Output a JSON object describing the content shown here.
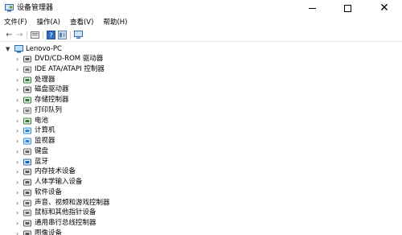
{
  "window": {
    "title": "设备管理器",
    "controls": {
      "minimize": "—",
      "maximize": "☐",
      "close": "✕"
    }
  },
  "menubar": {
    "items": [
      {
        "label": "文件(F)"
      },
      {
        "label": "操作(A)"
      },
      {
        "label": "查看(V)"
      },
      {
        "label": "帮助(H)"
      }
    ]
  },
  "toolbar": {
    "buttons": [
      {
        "icon": "back-arrow-icon",
        "glyph": "←"
      },
      {
        "icon": "forward-arrow-icon",
        "glyph": "→"
      },
      {
        "icon": "properties-icon",
        "glyph": "▤"
      },
      {
        "icon": "help-icon",
        "glyph": "?"
      },
      {
        "icon": "device-view-icon",
        "glyph": "▥"
      },
      {
        "icon": "monitor-scan-icon",
        "glyph": "▭"
      }
    ]
  },
  "tree": {
    "root": {
      "label": "Lenovo-PC",
      "expanded": true
    },
    "categories": [
      {
        "label": "DVD/CD-ROM 驱动器",
        "icon": "dvd-drive-icon",
        "color": "#555555"
      },
      {
        "label": "IDE ATA/ATAPI 控制器",
        "icon": "ide-controller-icon",
        "color": "#6a6a6a"
      },
      {
        "label": "处理器",
        "icon": "processor-icon",
        "color": "#2e7d32"
      },
      {
        "label": "磁盘驱动器",
        "icon": "disk-drive-icon",
        "color": "#555555"
      },
      {
        "label": "存储控制器",
        "icon": "storage-controller-icon",
        "color": "#2e7d32"
      },
      {
        "label": "打印队列",
        "icon": "print-queue-icon",
        "color": "#777777"
      },
      {
        "label": "电池",
        "icon": "battery-icon",
        "color": "#2e7d32"
      },
      {
        "label": "计算机",
        "icon": "computer-icon",
        "color": "#1e88e5"
      },
      {
        "label": "监视器",
        "icon": "monitor-icon",
        "color": "#1e88e5"
      },
      {
        "label": "键盘",
        "icon": "keyboard-icon",
        "color": "#666666"
      },
      {
        "label": "蓝牙",
        "icon": "bluetooth-icon",
        "color": "#1565c0"
      },
      {
        "label": "内存技术设备",
        "icon": "memory-device-icon",
        "color": "#555555"
      },
      {
        "label": "人体学输入设备",
        "icon": "hid-icon",
        "color": "#555555"
      },
      {
        "label": "软件设备",
        "icon": "software-device-icon",
        "color": "#555555"
      },
      {
        "label": "声音、视频和游戏控制器",
        "icon": "sound-icon",
        "color": "#666666"
      },
      {
        "label": "鼠标和其他指针设备",
        "icon": "mouse-icon",
        "color": "#666666"
      },
      {
        "label": "通用串行总线控制器",
        "icon": "usb-controller-icon",
        "color": "#555555"
      },
      {
        "label": "图像设备",
        "icon": "imaging-device-icon",
        "color": "#555555"
      }
    ]
  }
}
